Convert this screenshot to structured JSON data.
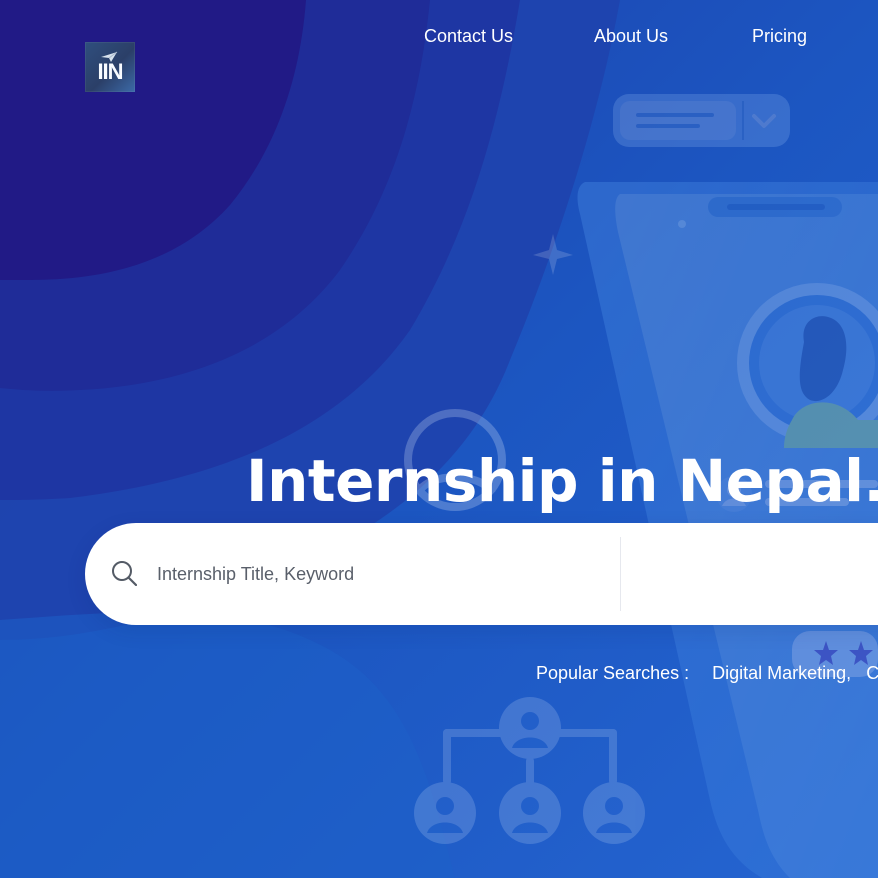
{
  "logo": {
    "text": "IIN",
    "icon": "paper-plane-icon"
  },
  "nav": {
    "items": [
      {
        "label": "Contact Us"
      },
      {
        "label": "About Us"
      },
      {
        "label": "Pricing"
      }
    ]
  },
  "hero": {
    "title_visible": "Internship in Nepal. W"
  },
  "search": {
    "keyword_placeholder": "Internship Title, Keyword",
    "keyword_value": "",
    "search_icon": "search-icon"
  },
  "popular": {
    "label": "Popular Searches :",
    "items": [
      "Digital Marketing,",
      "Co"
    ]
  },
  "colors": {
    "background_primary": "#1d4fb8",
    "background_secondary": "#2d8de8",
    "shape_dark": "#21218c",
    "text": "#ffffff",
    "input_bg": "#ffffff",
    "placeholder": "#595f6a"
  }
}
